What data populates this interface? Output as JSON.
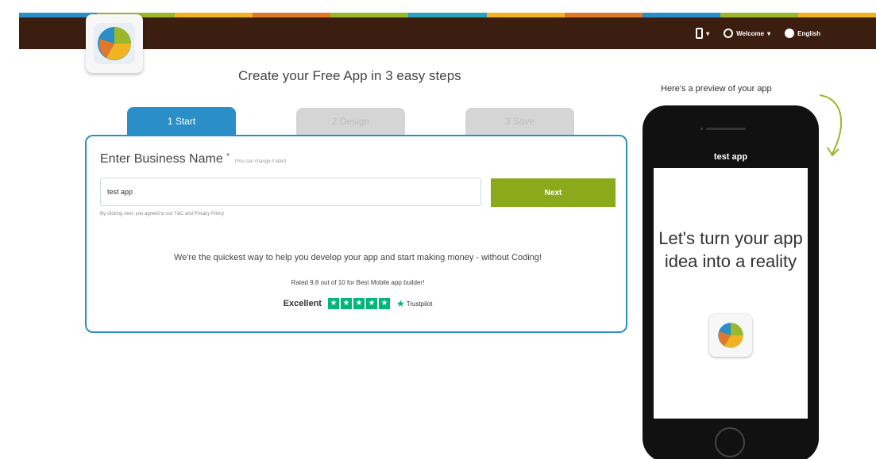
{
  "colors": {
    "topbar": "#3b1e10",
    "accent": "#2a8fc6",
    "next_button": "#8aaa1c",
    "trustpilot": "#00b67a",
    "stripe": [
      "#2a8fc6",
      "#9bb72b",
      "#f0b321",
      "#e0782b",
      "#9bb72b",
      "#2aa3b8",
      "#f0b321",
      "#e0782b",
      "#2a8fc6",
      "#9bb72b",
      "#f0b321"
    ]
  },
  "nav": {
    "device_icon": "mobile-icon",
    "welcome_label": "Welcome",
    "language_label": "English"
  },
  "header": {
    "headline": "Create your Free App in 3 easy steps"
  },
  "steps": {
    "step1": "1 Start",
    "step2": "2 Design",
    "step3": "3 Save"
  },
  "form": {
    "field_label": "Enter Business Name",
    "required_mark": "*",
    "field_hint": "(You can change it later)",
    "input_value": "test app",
    "next_label": "Next",
    "terms": "By clicking next, you agreed to our T&C and Privacy Policy"
  },
  "promo": {
    "pitch": "We're the quickest way to help you develop your app and start making money - without Coding!",
    "rating": "Rated 9.8 out of 10 for Best Mobile app builder!",
    "trust_word": "Excellent",
    "trust_brand": "Trustpilot",
    "stars": 5
  },
  "preview": {
    "label": "Here's a preview of your app",
    "app_name": "test app",
    "tagline": "Let's turn your app idea into a reality"
  }
}
